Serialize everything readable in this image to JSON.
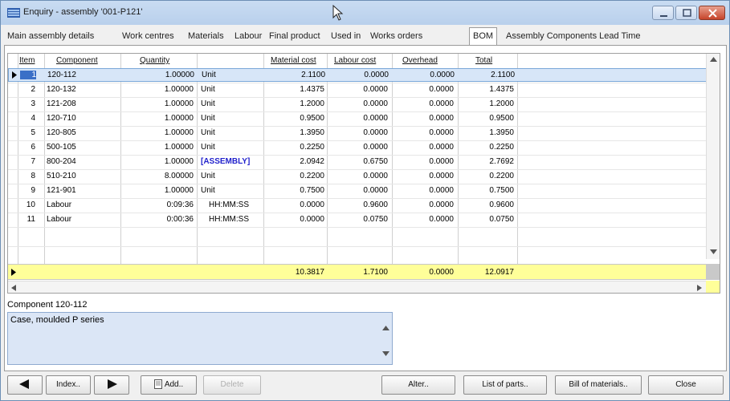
{
  "window": {
    "title": "Enquiry - assembly '001-P121'"
  },
  "tabs": [
    {
      "label": "Main assembly details",
      "active": false
    },
    {
      "label": "Work centres",
      "active": false
    },
    {
      "label": "Materials",
      "active": false
    },
    {
      "label": "Labour",
      "active": false
    },
    {
      "label": "Final product",
      "active": false
    },
    {
      "label": "Used in",
      "active": false
    },
    {
      "label": "Works orders",
      "active": false
    },
    {
      "label": "BOM",
      "active": true
    },
    {
      "label": "Assembly Components Lead Time",
      "active": false
    }
  ],
  "grid": {
    "columns": {
      "item": "Item",
      "component": "Component",
      "quantity": "Quantity",
      "unit": "",
      "material_cost": "Material cost",
      "labour_cost": "Labour cost",
      "overhead": "Overhead",
      "total": "Total"
    },
    "rows": [
      {
        "item": "1",
        "component": "120-112",
        "quantity": "1.00000",
        "unit": "Unit",
        "material_cost": "2.1100",
        "labour_cost": "0.0000",
        "overhead": "0.0000",
        "total": "2.1100"
      },
      {
        "item": "2",
        "component": "120-132",
        "quantity": "1.00000",
        "unit": "Unit",
        "material_cost": "1.4375",
        "labour_cost": "0.0000",
        "overhead": "0.0000",
        "total": "1.4375"
      },
      {
        "item": "3",
        "component": "121-208",
        "quantity": "1.00000",
        "unit": "Unit",
        "material_cost": "1.2000",
        "labour_cost": "0.0000",
        "overhead": "0.0000",
        "total": "1.2000"
      },
      {
        "item": "4",
        "component": "120-710",
        "quantity": "1.00000",
        "unit": "Unit",
        "material_cost": "0.9500",
        "labour_cost": "0.0000",
        "overhead": "0.0000",
        "total": "0.9500"
      },
      {
        "item": "5",
        "component": "120-805",
        "quantity": "1.00000",
        "unit": "Unit",
        "material_cost": "1.3950",
        "labour_cost": "0.0000",
        "overhead": "0.0000",
        "total": "1.3950"
      },
      {
        "item": "6",
        "component": "500-105",
        "quantity": "1.00000",
        "unit": "Unit",
        "material_cost": "0.2250",
        "labour_cost": "0.0000",
        "overhead": "0.0000",
        "total": "0.2250"
      },
      {
        "item": "7",
        "component": "800-204",
        "quantity": "1.00000",
        "unit": "[ASSEMBLY]",
        "material_cost": "2.0942",
        "labour_cost": "0.6750",
        "overhead": "0.0000",
        "total": "2.7692"
      },
      {
        "item": "8",
        "component": "510-210",
        "quantity": "8.00000",
        "unit": "Unit",
        "material_cost": "0.2200",
        "labour_cost": "0.0000",
        "overhead": "0.0000",
        "total": "0.2200"
      },
      {
        "item": "9",
        "component": "121-901",
        "quantity": "1.00000",
        "unit": "Unit",
        "material_cost": "0.7500",
        "labour_cost": "0.0000",
        "overhead": "0.0000",
        "total": "0.7500"
      },
      {
        "item": "10",
        "component": "Labour",
        "quantity": "0:09:36",
        "unit": "HH:MM:SS",
        "material_cost": "0.0000",
        "labour_cost": "0.9600",
        "overhead": "0.0000",
        "total": "0.9600"
      },
      {
        "item": "11",
        "component": "Labour",
        "quantity": "0:00:36",
        "unit": "HH:MM:SS",
        "material_cost": "0.0000",
        "labour_cost": "0.0750",
        "overhead": "0.0000",
        "total": "0.0750"
      }
    ],
    "totals": {
      "material_cost": "10.3817",
      "labour_cost": "1.7100",
      "overhead": "0.0000",
      "total": "12.0917"
    }
  },
  "detail": {
    "component_label": "Component 120-112",
    "description": "Case, moulded P series"
  },
  "buttons": {
    "index": "Index..",
    "add": "Add..",
    "delete": "Delete",
    "alter": "Alter..",
    "list_of_parts": "List of parts..",
    "bill_of_materials": "Bill of materials..",
    "close": "Close"
  },
  "colors": {
    "selected_row": "#d7e6f8",
    "totals_row": "#ffff99",
    "description_bg": "#dbe6f6",
    "assembly_text": "#2222cc"
  }
}
